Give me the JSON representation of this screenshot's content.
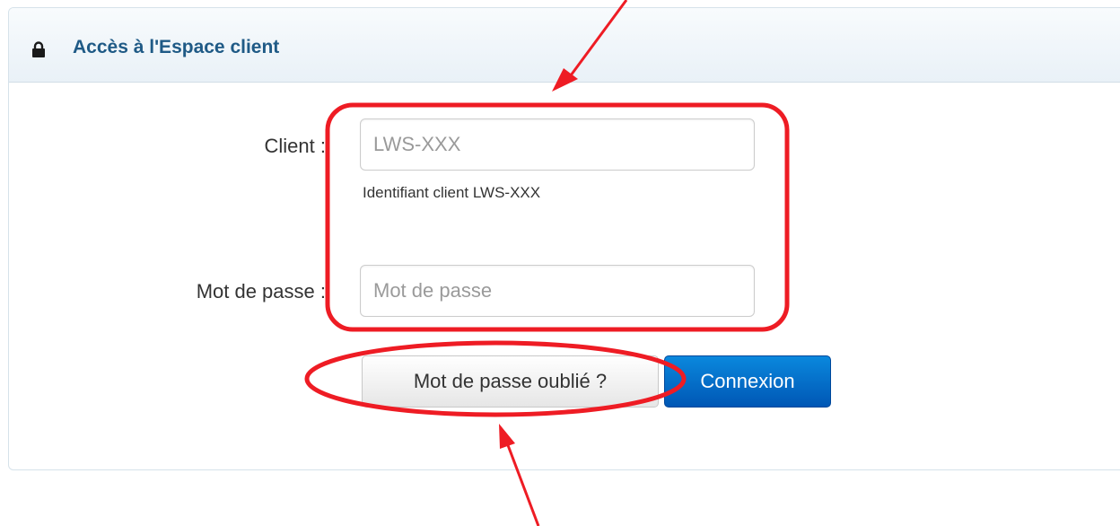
{
  "panel": {
    "title": "Accès à l'Espace client",
    "title_icon": "lock-icon",
    "title_color": "#1f5a86"
  },
  "form": {
    "client_label": "Client :",
    "client_placeholder": "LWS-XXX",
    "client_help": "Identifiant client LWS-XXX",
    "password_label": "Mot de passe :",
    "password_placeholder": "Mot de passe"
  },
  "buttons": {
    "forgot_label": "Mot de passe oublié ?",
    "login_label": "Connexion",
    "login_color": "#0a6fcf"
  },
  "annotations": {
    "highlight_color": "#ee1c24",
    "items": [
      "arrow-down-to-fields",
      "fields-highlight-box",
      "forgot-highlight-ellipse",
      "arrow-up-to-forgot"
    ]
  }
}
